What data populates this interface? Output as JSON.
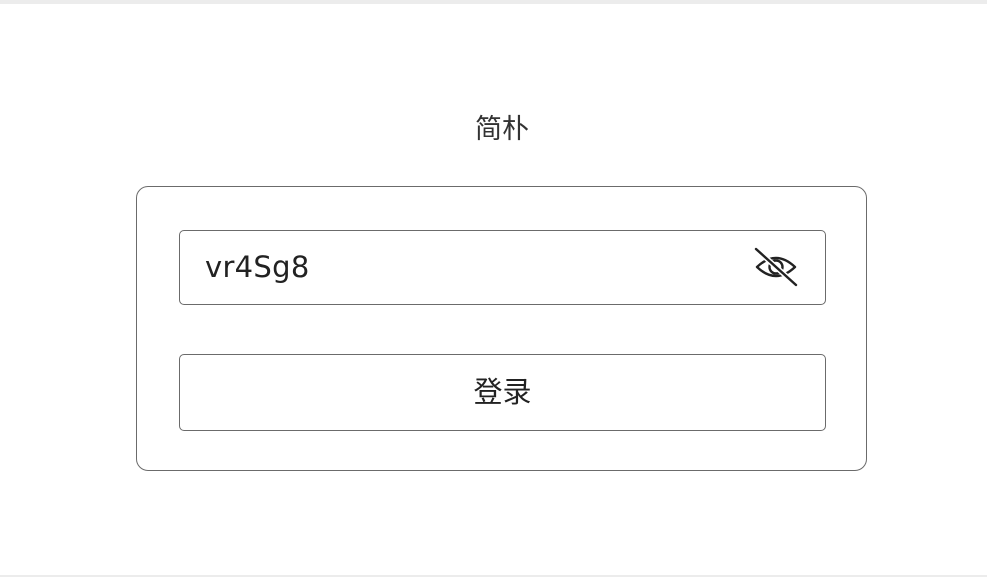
{
  "app": {
    "title": "简朴"
  },
  "login": {
    "password_value": "vr4Sg8",
    "visibility_icon": "eye-off-icon",
    "submit_label": "登录"
  }
}
